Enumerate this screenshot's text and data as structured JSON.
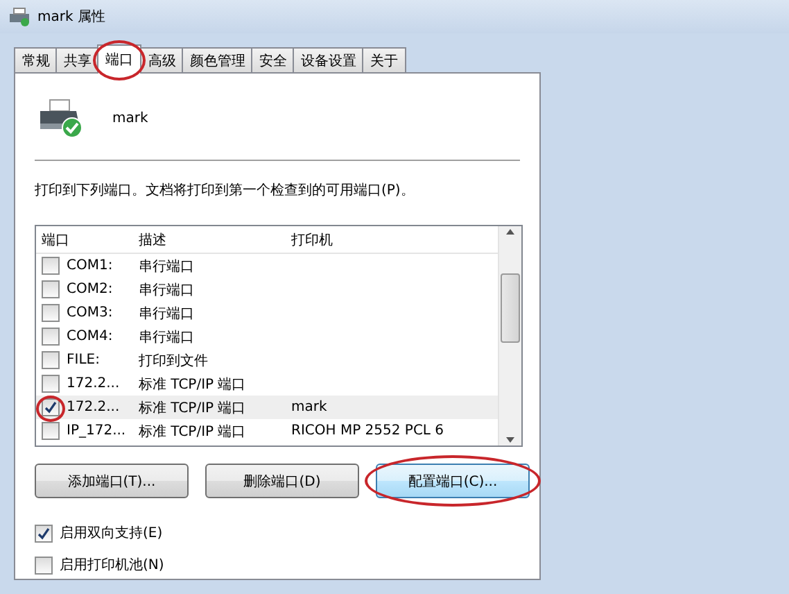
{
  "window": {
    "title": "mark 属性"
  },
  "tabs": [
    {
      "label": "常规",
      "selected": false,
      "circled": false
    },
    {
      "label": "共享",
      "selected": false,
      "circled": false
    },
    {
      "label": "端口",
      "selected": true,
      "circled": true
    },
    {
      "label": "高级",
      "selected": false,
      "circled": false
    },
    {
      "label": "颜色管理",
      "selected": false,
      "circled": false
    },
    {
      "label": "安全",
      "selected": false,
      "circled": false
    },
    {
      "label": "设备设置",
      "selected": false,
      "circled": false
    },
    {
      "label": "关于",
      "selected": false,
      "circled": false
    }
  ],
  "printer_name": "mark",
  "instruction": "打印到下列端口。文档将打印到第一个检查到的可用端口(P)。",
  "port_list": {
    "columns": [
      "端口",
      "描述",
      "打印机"
    ],
    "rows": [
      {
        "port": "COM1:",
        "description": "串行端口",
        "printer": "",
        "checked": false,
        "selected": false,
        "circled": false
      },
      {
        "port": "COM2:",
        "description": "串行端口",
        "printer": "",
        "checked": false,
        "selected": false,
        "circled": false
      },
      {
        "port": "COM3:",
        "description": "串行端口",
        "printer": "",
        "checked": false,
        "selected": false,
        "circled": false
      },
      {
        "port": "COM4:",
        "description": "串行端口",
        "printer": "",
        "checked": false,
        "selected": false,
        "circled": false
      },
      {
        "port": "FILE:",
        "description": "打印到文件",
        "printer": "",
        "checked": false,
        "selected": false,
        "circled": false
      },
      {
        "port": "172.2...",
        "description": "标准 TCP/IP 端口",
        "printer": "",
        "checked": false,
        "selected": false,
        "circled": false
      },
      {
        "port": "172.2...",
        "description": "标准 TCP/IP 端口",
        "printer": "mark",
        "checked": true,
        "selected": true,
        "circled": true
      },
      {
        "port": "IP_172...",
        "description": "标准 TCP/IP 端口",
        "printer": "RICOH MP 2552 PCL 6",
        "checked": false,
        "selected": false,
        "circled": false
      }
    ]
  },
  "buttons": [
    {
      "label": "添加端口(T)...",
      "circled": false,
      "focused": false
    },
    {
      "label": "删除端口(D)",
      "circled": false,
      "focused": false
    },
    {
      "label": "配置端口(C)...",
      "circled": true,
      "focused": true
    }
  ],
  "options": [
    {
      "label": "启用双向支持(E)",
      "checked": true
    },
    {
      "label": "启用打印机池(N)",
      "checked": false
    }
  ]
}
